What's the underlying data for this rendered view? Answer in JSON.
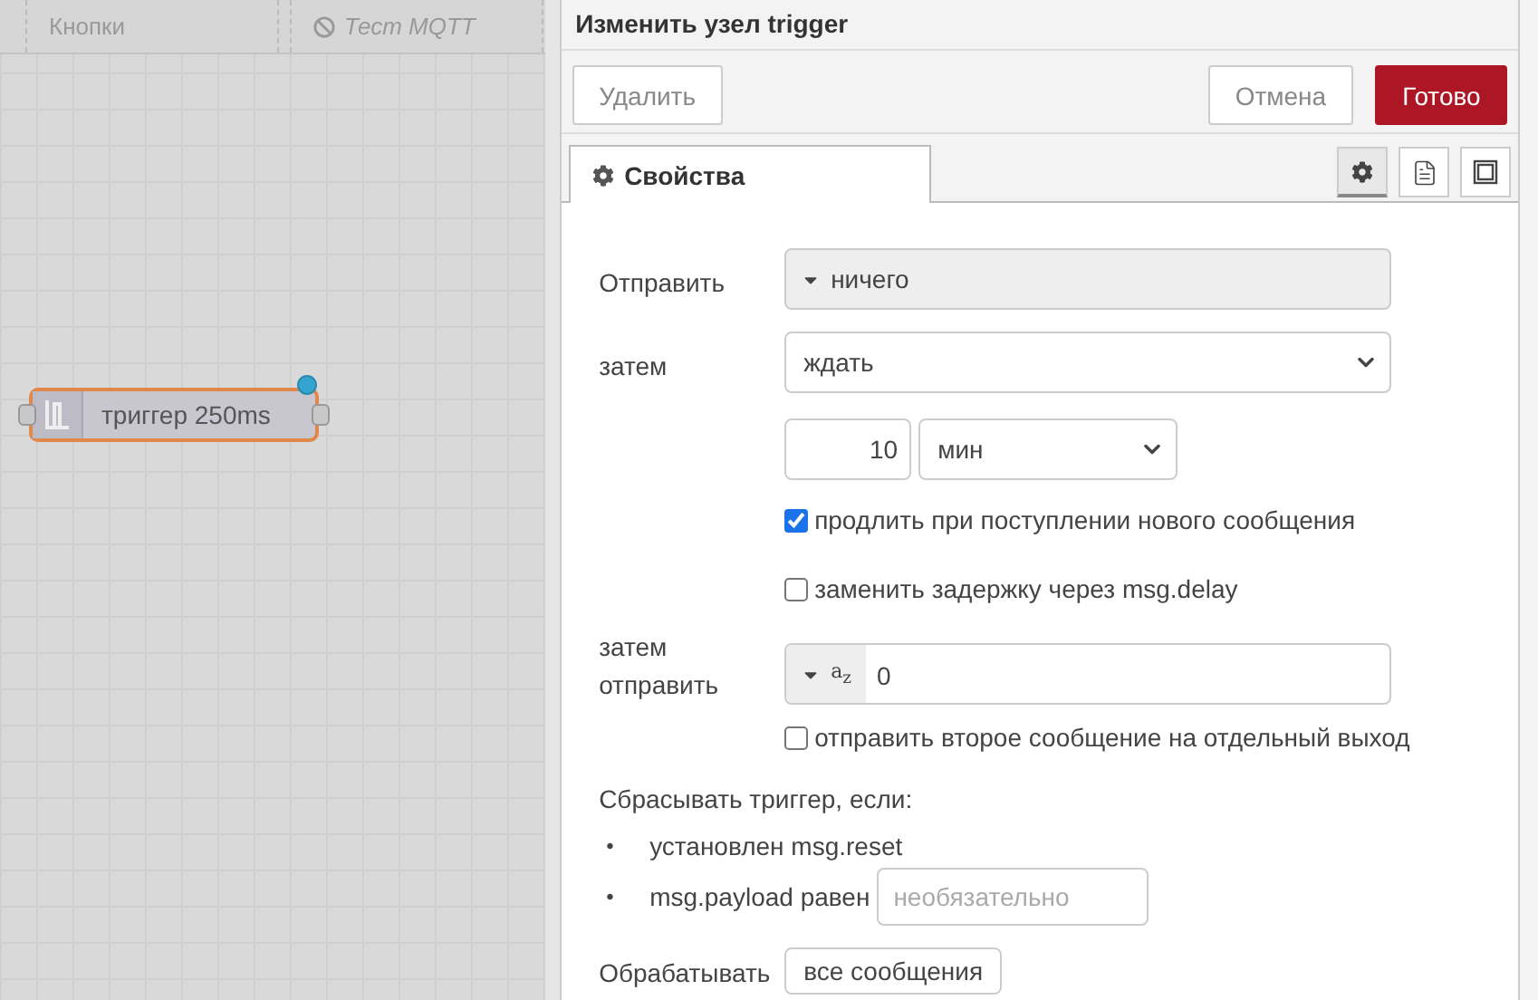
{
  "workspace_tabs": [
    {
      "label": "Кнопки",
      "disabled": false
    },
    {
      "label": "Тест MQTT",
      "disabled": true
    }
  ],
  "node": {
    "label": "триггер 250ms",
    "changed": true
  },
  "editor": {
    "title": "Изменить узел trigger",
    "buttons": [
      {
        "label": "Удалить",
        "kind": "plain"
      },
      {
        "label": "Отмена",
        "kind": "plain"
      },
      {
        "label": "Готово",
        "kind": "primary"
      }
    ],
    "tabs": [
      {
        "label": "Свойства",
        "selected": true
      }
    ],
    "tab_icons": [
      {
        "kind": "gear",
        "selected": true
      },
      {
        "kind": "doc",
        "selected": false
      },
      {
        "kind": "frame",
        "selected": false
      }
    ],
    "send": {
      "label": "Отправить",
      "value": "ничего"
    },
    "then": {
      "label": "затем",
      "value": "ждать"
    },
    "delay": {
      "value": "10",
      "unit": "мин"
    },
    "options": [
      {
        "label": "продлить при поступлении нового сообщения",
        "checked": true
      },
      {
        "label": "заменить задержку через msg.delay",
        "checked": false
      }
    ],
    "then_send": {
      "label": "затем отправить",
      "type_glyph_top": "a",
      "type_glyph_bottom": "z",
      "value": "0"
    },
    "second_output": {
      "label": "отправить второе сообщение на отдельный выход",
      "checked": false
    },
    "reset": {
      "title": "Сбрасывать триггер, если:",
      "items": [
        {
          "bullet": "•",
          "text": "установлен msg.reset",
          "kind": "text"
        },
        {
          "bullet": "•",
          "text": "msg.payload равен",
          "kind": "input",
          "placeholder": "необязательно"
        }
      ]
    },
    "handle": {
      "label": "Обрабатывать",
      "value": "все сообщения"
    }
  }
}
